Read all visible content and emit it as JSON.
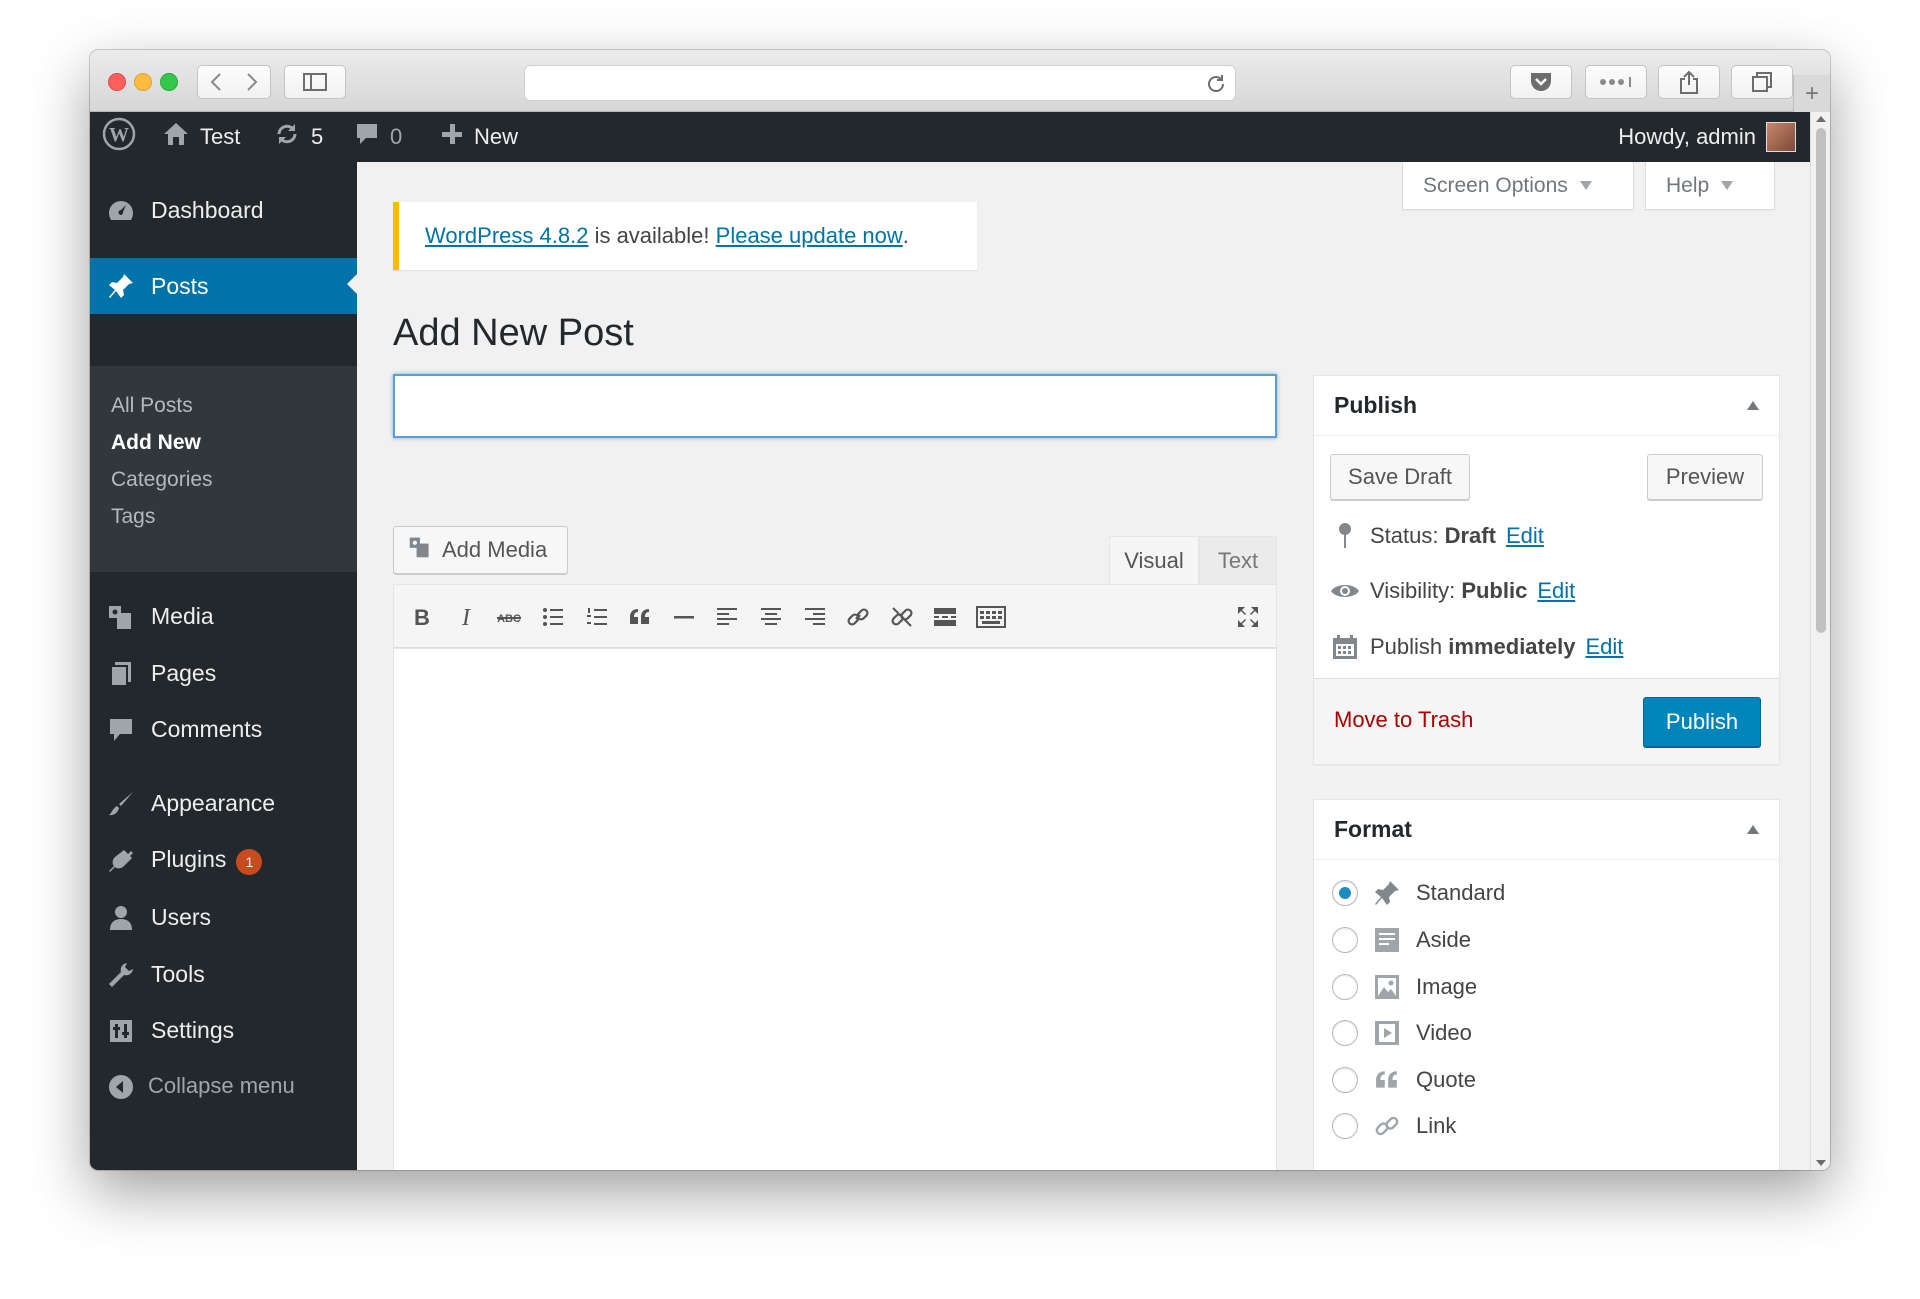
{
  "admin_bar": {
    "site_name": "Test",
    "updates_count": "5",
    "comments_count": "0",
    "new_label": "New",
    "greeting": "Howdy, admin"
  },
  "sidebar": {
    "dashboard": "Dashboard",
    "posts": "Posts",
    "submenu": [
      "All Posts",
      "Add New",
      "Categories",
      "Tags"
    ],
    "media": "Media",
    "pages": "Pages",
    "comments": "Comments",
    "appearance": "Appearance",
    "plugins": "Plugins",
    "plugins_badge": "1",
    "users": "Users",
    "tools": "Tools",
    "settings": "Settings",
    "collapse": "Collapse menu"
  },
  "screen_meta": {
    "screen_options": "Screen Options",
    "help": "Help"
  },
  "notice": {
    "version_link": "WordPress 4.8.2",
    "text": " is available! ",
    "update_link": "Please update now",
    "tail": "."
  },
  "page": {
    "title": "Add New Post",
    "title_input_value": "",
    "title_placeholder": ""
  },
  "editor": {
    "add_media": "Add Media",
    "tab_visual": "Visual",
    "tab_text": "Text",
    "active_tab": "Visual",
    "toolbar_icons": [
      "bold-icon",
      "italic-icon",
      "strikethrough-icon",
      "bullet-list-icon",
      "numbered-list-icon",
      "blockquote-icon",
      "horizontal-line-icon",
      "align-left-icon",
      "align-center-icon",
      "align-right-icon",
      "link-icon",
      "unlink-icon",
      "read-more-icon",
      "toolbar-toggle-icon",
      "fullscreen-icon"
    ]
  },
  "publish_box": {
    "title": "Publish",
    "save_draft": "Save Draft",
    "preview": "Preview",
    "status_label": "Status:",
    "status_value": "Draft",
    "visibility_label": "Visibility:",
    "visibility_value": "Public",
    "publish_label": "Publish",
    "publish_value": "immediately",
    "edit": "Edit",
    "move_to_trash": "Move to Trash",
    "publish_button": "Publish"
  },
  "format_box": {
    "title": "Format",
    "selected": "Standard",
    "options": [
      "Standard",
      "Aside",
      "Image",
      "Video",
      "Quote",
      "Link"
    ]
  },
  "colors": {
    "admin_bar": "#23282d",
    "active_menu": "#0073aa",
    "publish_button": "#0085ba",
    "notice_border": "#ffb900",
    "trash_link": "#aa0000",
    "badge": "#ca4a1f"
  }
}
